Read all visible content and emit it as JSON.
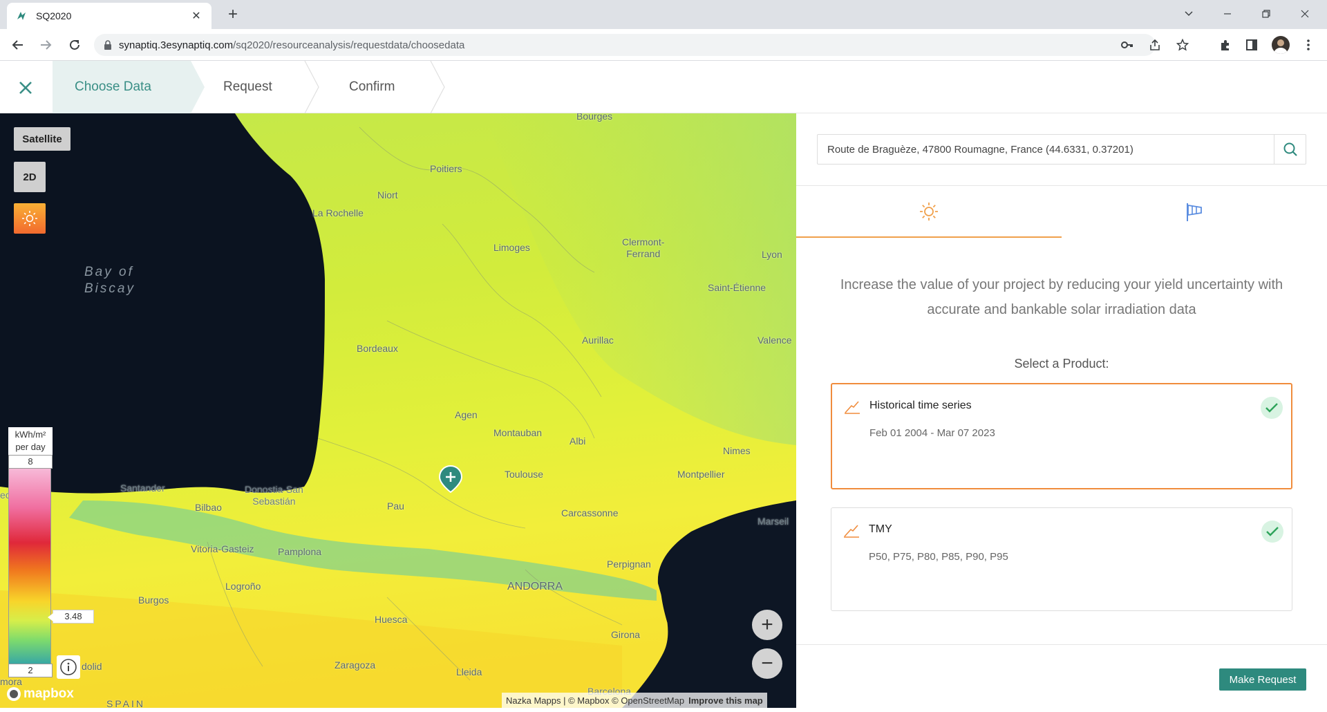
{
  "browser": {
    "tab_title": "SQ2020",
    "url_host": "synaptiq.3esynaptiq.com",
    "url_path": "/sq2020/resourceanalysis/requestdata/choosedata"
  },
  "stepper": {
    "steps": [
      "Choose Data",
      "Request",
      "Confirm"
    ],
    "active_step": 0
  },
  "map": {
    "style_button": "Satellite",
    "view_button": "2D",
    "sea_label": "Bay of\nBiscay",
    "cities": [
      "Bourges",
      "Poitiers",
      "Niort",
      "La Rochelle",
      "Limoges",
      "Clermont-\nFerrand",
      "Lyon",
      "Saint-Étienne",
      "Bordeaux",
      "Aurillac",
      "Valence",
      "Agen",
      "Montauban",
      "Albi",
      "Nimes",
      "Toulouse",
      "Montpellier",
      "Santander",
      "Donostia-San\nSebastián",
      "Bilbao",
      "Pau",
      "Carcassonne",
      "Marseil",
      "Vitoria-Gasteiz",
      "Pamplona",
      "Perpignan",
      "Logroño",
      "ANDORRA",
      "Burgos",
      "Huesca",
      "Girona",
      "Zaragoza",
      "Lleida",
      "Barcelona",
      "dolid",
      "mora",
      "SPAIN",
      "ec"
    ],
    "legend": {
      "unit": "kWh/m²\nper day",
      "max": "8",
      "min": "2",
      "current_value": "3.48"
    },
    "zoom_in": "+",
    "zoom_out": "−",
    "mapbox_logo": "mapbox",
    "attribution": "Nazka Mapps | © Mapbox © OpenStreetMap",
    "attribution_improve": "Improve this map",
    "marker_icon": "plus-pin-icon"
  },
  "panel": {
    "search_value": "Route de Braguèze, 47800 Roumagne, France (44.6331, 0.37201)",
    "tabs": [
      {
        "icon": "sun-icon",
        "active": true
      },
      {
        "icon": "windsock-icon",
        "active": false
      }
    ],
    "intro": "Increase the value of your project by reducing your yield uncertainty with accurate and bankable solar irradiation data",
    "select_label": "Select a Product:",
    "products": [
      {
        "title": "Historical time series",
        "subtitle": "Feb 01 2004 - Mar 07 2023",
        "selected": true,
        "checked": true
      },
      {
        "title": "TMY",
        "subtitle": "P50, P75, P80, P85, P90, P95",
        "selected": false,
        "checked": true
      }
    ],
    "make_request": "Make Request"
  },
  "colors": {
    "accent_teal": "#2e8a7e",
    "accent_orange": "#f08c3c",
    "step_active_bg": "#e7f1f0"
  }
}
